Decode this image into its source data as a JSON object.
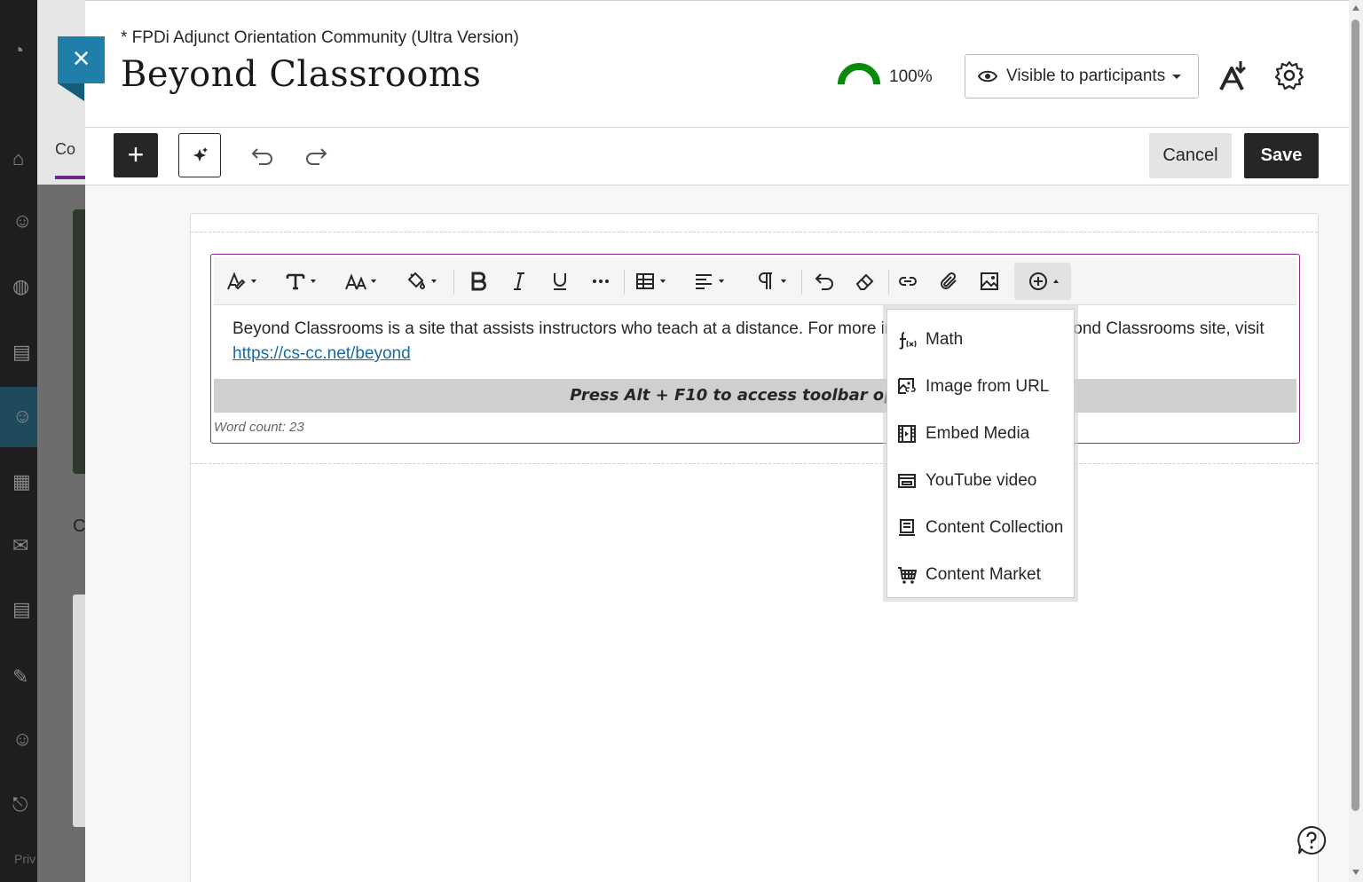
{
  "background": {
    "tab_fragment": "Co",
    "heading_fragment": "C",
    "footer_fragment": "Priv"
  },
  "header": {
    "breadcrumb": "* FPDi Adjunct Orientation Community (Ultra Version)",
    "title": "Beyond Classrooms",
    "progress_label": "100%",
    "progress_value": 1.0,
    "progress_color": "#0a8a0a",
    "visibility_label": "Visible to participants",
    "close_label": "×"
  },
  "toolbar": {
    "add_label": "+",
    "cancel_label": "Cancel",
    "save_label": "Save"
  },
  "editor": {
    "formatting_tools": [
      "text-style",
      "heading",
      "font-size",
      "highlight",
      "bold",
      "italic",
      "underline",
      "more",
      "table",
      "align",
      "paragraph",
      "undo",
      "clear-format",
      "link",
      "attach",
      "image",
      "insert-content"
    ],
    "body_text": "Beyond Classrooms is a site that assists instructors who teach at a distance. For more information about the Beyond Classrooms site, visit ",
    "body_link": "https://cs-cc.net/beyond",
    "alt_hint": "Press Alt + F10 to access toolbar options",
    "word_count": "Word count: 23"
  },
  "insert_menu": {
    "items": [
      {
        "label": "Math",
        "icon": "math-icon"
      },
      {
        "label": "Image from URL",
        "icon": "image-url-icon"
      },
      {
        "label": "Embed Media",
        "icon": "film-icon"
      },
      {
        "label": "YouTube video",
        "icon": "video-window-icon"
      },
      {
        "label": "Content Collection",
        "icon": "collection-icon"
      },
      {
        "label": "Content Market",
        "icon": "cart-icon"
      }
    ]
  },
  "colors": {
    "accent": "#8a2c91",
    "close_tab": "#1f7fa8",
    "dark_button": "#262626",
    "link": "#1a6aa0"
  }
}
